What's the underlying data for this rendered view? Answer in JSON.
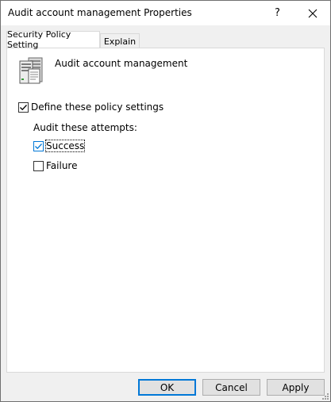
{
  "window": {
    "title": "Audit account management Properties",
    "help_label": "?",
    "close_icon": "close-icon"
  },
  "tabs": [
    {
      "label": "Security Policy Setting",
      "active": true
    },
    {
      "label": "Explain",
      "active": false
    }
  ],
  "policy": {
    "icon": "server-policy-icon",
    "name": "Audit account management"
  },
  "settings": {
    "define_label": "Define these policy settings",
    "define_checked": true,
    "attempts_label": "Audit these attempts:",
    "success_label": "Success",
    "success_checked": true,
    "failure_label": "Failure",
    "failure_checked": false
  },
  "buttons": {
    "ok": "OK",
    "cancel": "Cancel",
    "apply": "Apply"
  },
  "colors": {
    "accent": "#0078d7",
    "window_bg": "#f0f0f0",
    "panel_bg": "#ffffff"
  }
}
